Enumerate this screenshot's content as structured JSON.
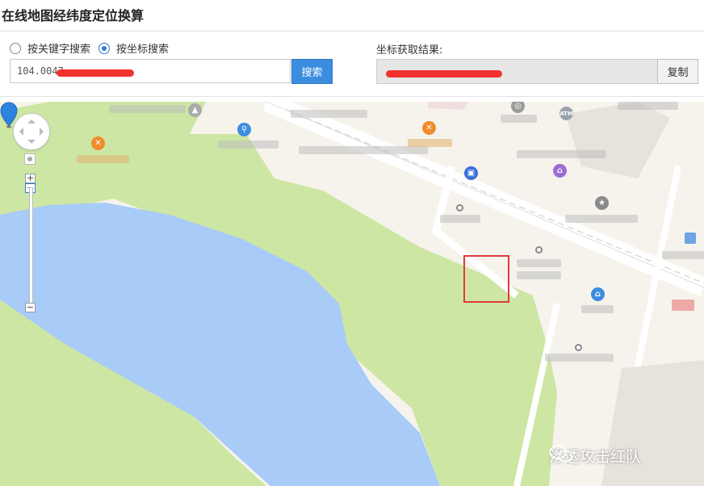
{
  "page_title": "在线地图经纬度定位换算",
  "search": {
    "option_keyword": "按关键字搜索",
    "option_coordinate": "按坐标搜索",
    "selected": "coordinate",
    "input_value": "104.0047",
    "search_button": "搜索"
  },
  "result": {
    "label": "坐标获取结果:",
    "copy_button": "复制"
  },
  "map": {
    "colors": {
      "land": "#f6f3ec",
      "park": "#cde6a4",
      "water": "#a8cbf7",
      "marker": "#2f82e0",
      "highlight": "#e23a3a"
    },
    "labels": {
      "atm": "ATM"
    },
    "icons": [
      "restaurant-icon",
      "bicycle-icon",
      "bus-icon",
      "atm-icon",
      "bank-icon",
      "star-icon",
      "university-icon"
    ]
  },
  "watermark": "渗透攻击红队"
}
